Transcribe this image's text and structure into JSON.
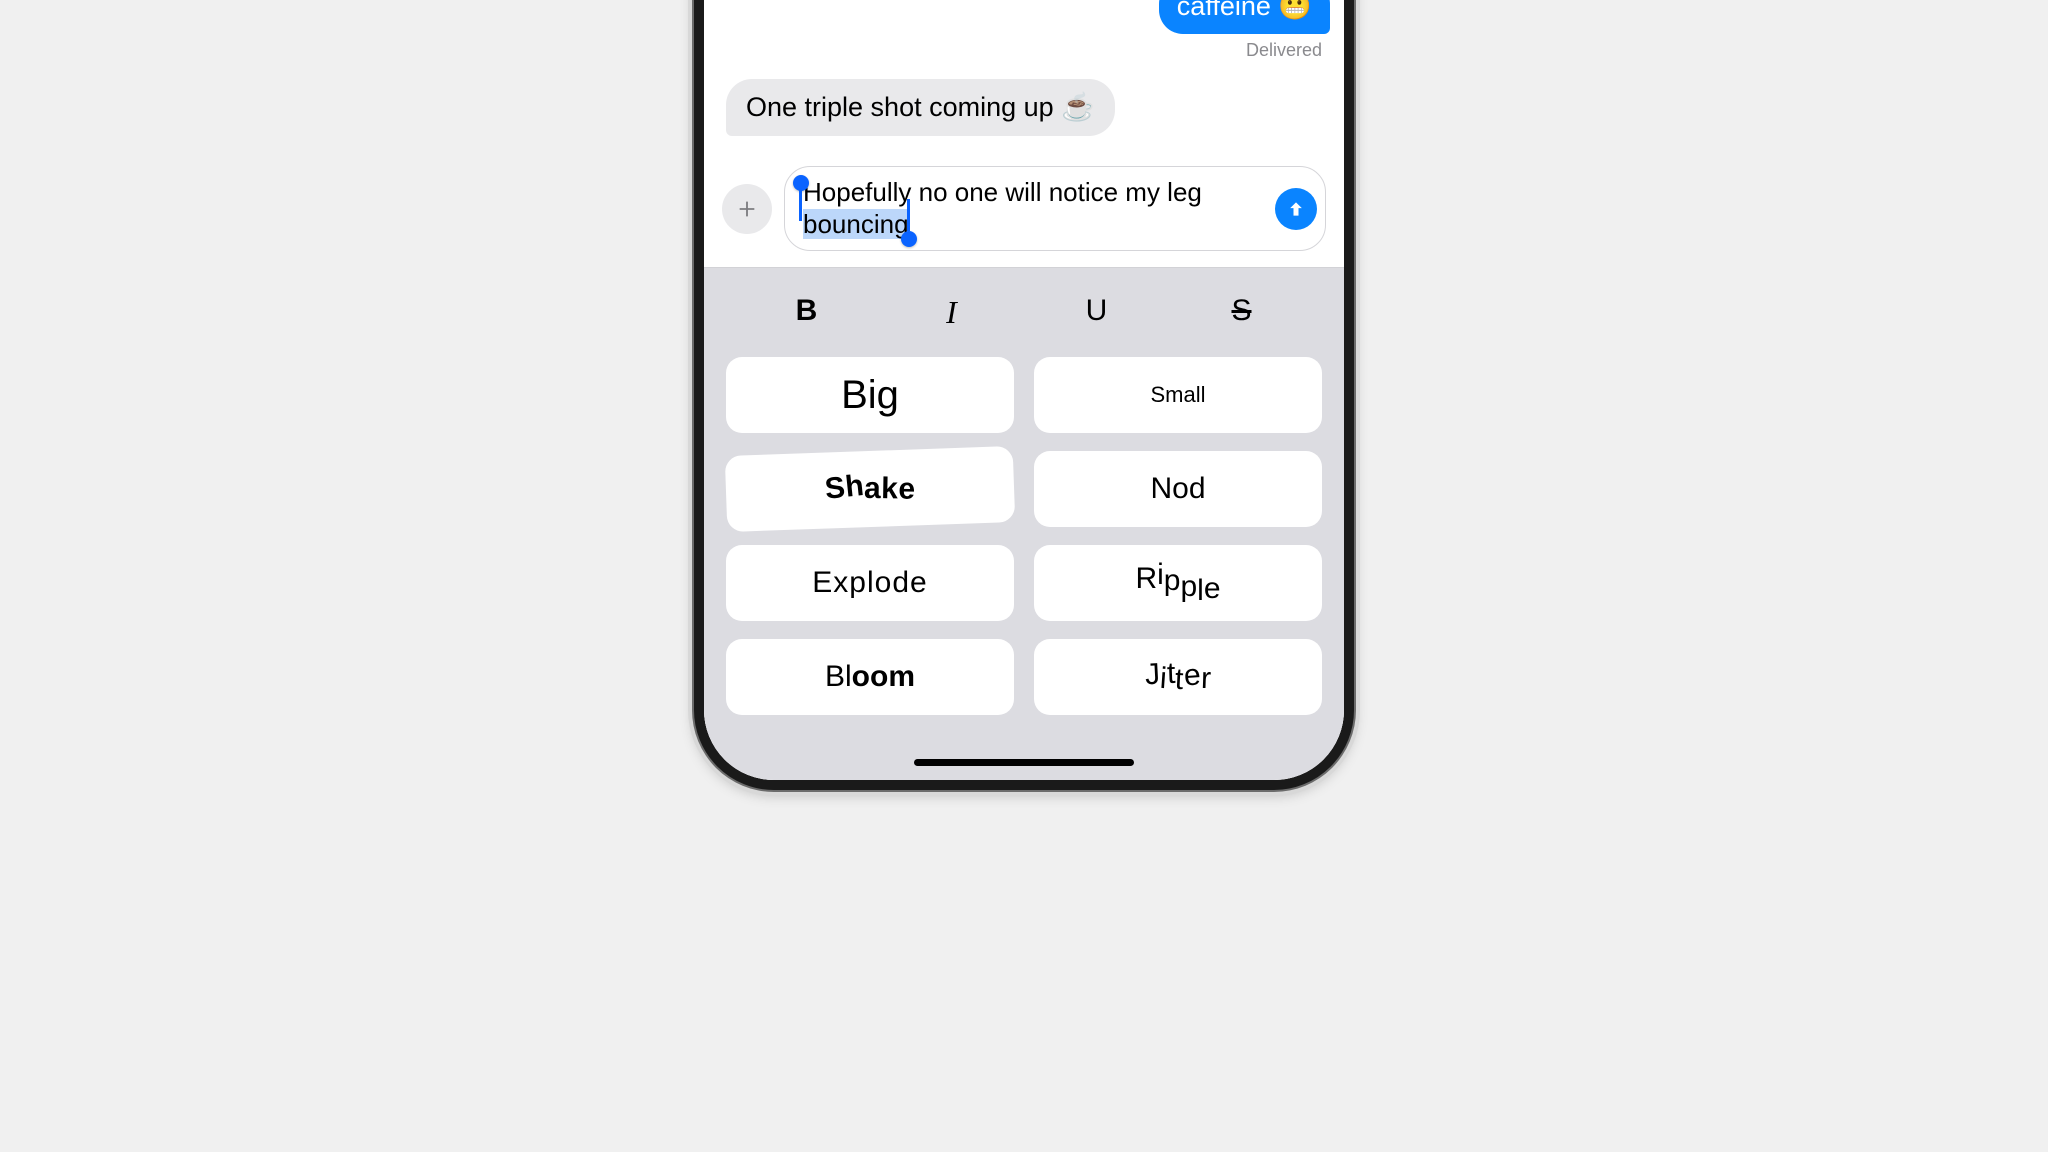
{
  "conversation": {
    "sent_tail": "caffeine 😬",
    "delivered": "Delivered",
    "received": "One triple shot coming up ☕️"
  },
  "compose": {
    "text_unselected": "Hopefully no one will notice my leg ",
    "text_selected": "bouncing"
  },
  "format": {
    "bold": "B",
    "italic": "I",
    "underline": "U",
    "strike": "S"
  },
  "effects": {
    "big": "Big",
    "small": "Small",
    "shake": "Shake",
    "nod": "Nod",
    "explode": "Explode",
    "ripple": "Ripple",
    "bloom": "Bloom",
    "jitter": "Jitter"
  }
}
